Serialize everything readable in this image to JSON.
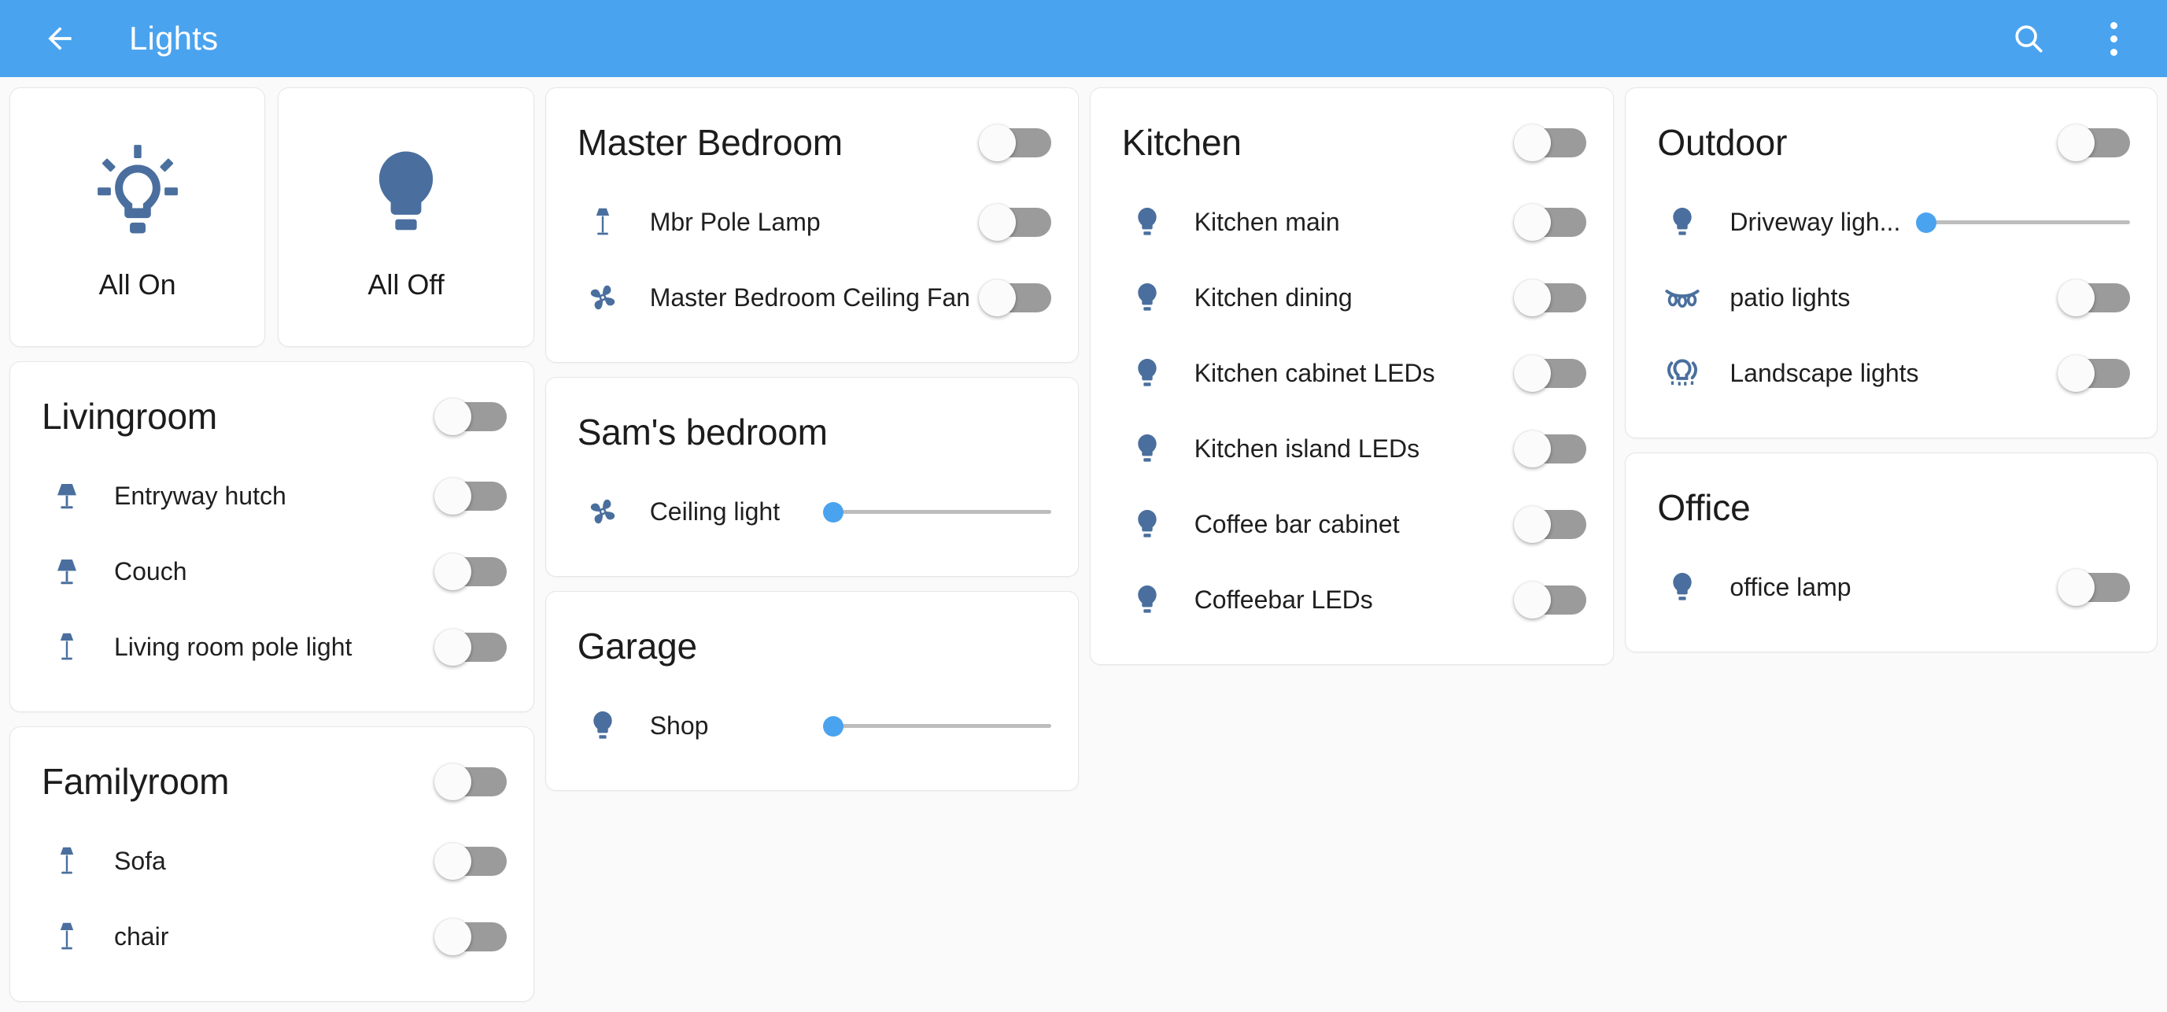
{
  "header": {
    "title": "Lights",
    "back_icon": "arrow-left-icon",
    "search_icon": "search-icon",
    "overflow_icon": "more-vertical-icon",
    "background_color": "#4aa3ef"
  },
  "colors": {
    "accent_blue": "#4aa3ef",
    "icon_blue": "#4a6f9e",
    "toggle_off_track": "#9b9b9b",
    "toggle_thumb": "#fbfbfb",
    "slider_track": "#bdbdbd",
    "page_background": "#fafafa",
    "card_background": "#ffffff"
  },
  "quick_actions": [
    {
      "label": "All On",
      "icon": "lightbulb-on-icon",
      "name": "all-on-button"
    },
    {
      "label": "All Off",
      "icon": "lightbulb-off-icon",
      "name": "all-off-button"
    }
  ],
  "rooms": [
    {
      "title": "Livingroom",
      "has_header_toggle": true,
      "header_toggle_state": "off",
      "lights": [
        {
          "label": "Entryway hutch",
          "icon": "table-lamp-icon",
          "control": "toggle",
          "state": "off"
        },
        {
          "label": "Couch",
          "icon": "table-lamp-icon",
          "control": "toggle",
          "state": "off"
        },
        {
          "label": "Living room pole light",
          "icon": "floor-lamp-icon",
          "control": "toggle",
          "state": "off"
        }
      ]
    },
    {
      "title": "Familyroom",
      "has_header_toggle": true,
      "header_toggle_state": "off",
      "lights": [
        {
          "label": "Sofa",
          "icon": "floor-lamp-icon",
          "control": "toggle",
          "state": "off"
        },
        {
          "label": "chair",
          "icon": "floor-lamp-icon",
          "control": "toggle",
          "state": "off"
        }
      ]
    },
    {
      "title": "Master Bedroom",
      "has_header_toggle": true,
      "header_toggle_state": "off",
      "lights": [
        {
          "label": "Mbr Pole Lamp",
          "icon": "floor-lamp-icon",
          "control": "toggle",
          "state": "off"
        },
        {
          "label": "Master Bedroom Ceiling Fan ...",
          "icon": "ceiling-fan-icon",
          "control": "toggle",
          "state": "off"
        }
      ]
    },
    {
      "title": "Sam's bedroom",
      "has_header_toggle": false,
      "lights": [
        {
          "label": "Ceiling light",
          "icon": "ceiling-fan-icon",
          "control": "slider",
          "value": 0
        }
      ]
    },
    {
      "title": "Garage",
      "has_header_toggle": false,
      "lights": [
        {
          "label": "Shop",
          "icon": "lightbulb-icon",
          "control": "slider",
          "value": 0
        }
      ]
    },
    {
      "title": "Kitchen",
      "has_header_toggle": true,
      "header_toggle_state": "off",
      "lights": [
        {
          "label": "Kitchen main",
          "icon": "lightbulb-icon",
          "control": "toggle",
          "state": "off"
        },
        {
          "label": "Kitchen dining",
          "icon": "lightbulb-icon",
          "control": "toggle",
          "state": "off"
        },
        {
          "label": "Kitchen cabinet LEDs",
          "icon": "lightbulb-icon",
          "control": "toggle",
          "state": "off"
        },
        {
          "label": "Kitchen island LEDs",
          "icon": "lightbulb-icon",
          "control": "toggle",
          "state": "off"
        },
        {
          "label": "Coffee bar cabinet",
          "icon": "lightbulb-icon",
          "control": "toggle",
          "state": "off"
        },
        {
          "label": "Coffeebar LEDs",
          "icon": "lightbulb-icon",
          "control": "toggle",
          "state": "off"
        }
      ]
    },
    {
      "title": "Outdoor",
      "has_header_toggle": true,
      "header_toggle_state": "off",
      "lights": [
        {
          "label": "Driveway ligh...",
          "icon": "lightbulb-icon",
          "control": "slider",
          "value": 0
        },
        {
          "label": "patio lights",
          "icon": "string-lights-icon",
          "control": "toggle",
          "state": "off"
        },
        {
          "label": "Landscape lights",
          "icon": "flood-light-icon",
          "control": "toggle",
          "state": "off"
        }
      ]
    },
    {
      "title": "Office",
      "has_header_toggle": false,
      "lights": [
        {
          "label": "office lamp",
          "icon": "lightbulb-icon",
          "control": "toggle",
          "state": "off"
        }
      ]
    }
  ]
}
